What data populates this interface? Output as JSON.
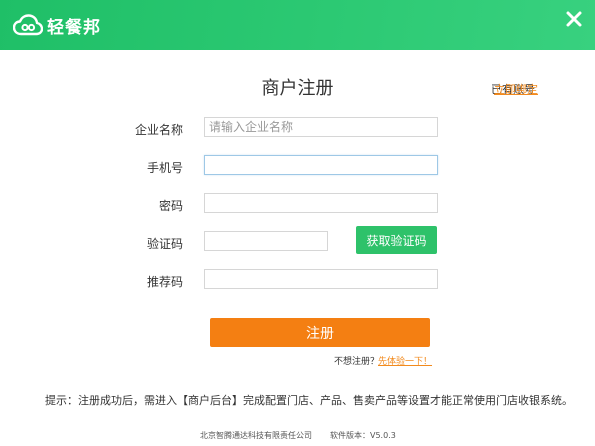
{
  "header": {
    "app_name": "轻餐邦",
    "brand_color": "#2cc973"
  },
  "form": {
    "title": "商户注册",
    "have_account": "已有账号",
    "bind_link": "立即绑定",
    "company": {
      "label": "企业名称",
      "placeholder": "请输入企业名称",
      "value": ""
    },
    "phone": {
      "label": "手机号",
      "value": ""
    },
    "password": {
      "label": "密码",
      "value": ""
    },
    "code": {
      "label": "验证码",
      "value": ""
    },
    "referral": {
      "label": "推荐码",
      "value": ""
    },
    "sms_button": "获取验证码",
    "register_button": "注册",
    "skip_text": "不想注册？",
    "skip_link": "先体验一下！"
  },
  "tip": "提示：注册成功后，需进入【商户后台】完成配置门店、产品、售卖产品等设置才能正常使用门店收银系统。",
  "footer": {
    "company": "北京智腾通达科技有限责任公司",
    "version": "软件版本：V5.0.3"
  },
  "colors": {
    "accent_green": "#2ec26a",
    "accent_orange": "#f47f12",
    "link_orange": "#f28a1d"
  },
  "icons": [
    "cloud-logo-icon",
    "close-icon"
  ]
}
